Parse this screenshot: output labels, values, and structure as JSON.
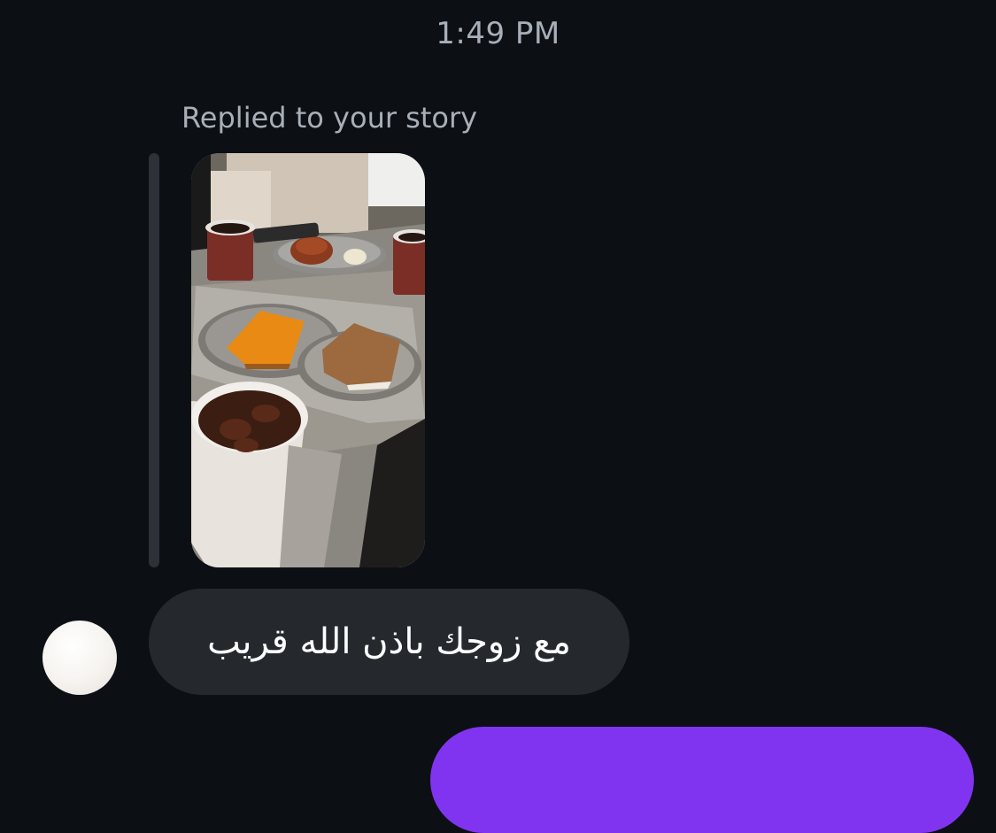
{
  "status": {
    "time": "1:49 PM"
  },
  "story_reply": {
    "label": "Replied to your story",
    "image_subject": "cafe table with coffee cups, pastries and iced drink"
  },
  "messages": [
    {
      "direction": "incoming",
      "text": "مع زوجك باذن الله قريب"
    },
    {
      "direction": "outgoing",
      "text": ""
    }
  ],
  "colors": {
    "background": "#0c1014",
    "incoming_bubble": "#25292e",
    "outgoing_bubble": "#8134f0",
    "secondary_text": "#a8afb8"
  }
}
